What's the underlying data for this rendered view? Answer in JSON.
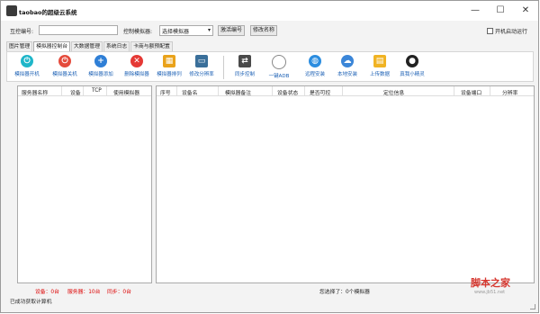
{
  "window": {
    "title": "taobao的超级云系统",
    "minimize": "—",
    "maximize": "☐",
    "close": "✕"
  },
  "controls": {
    "number_label": "互控编号:",
    "number_value": "",
    "control_sim_label": "控制模拟器:",
    "control_sim_value": "选择模拟器",
    "activate_label": "激活编号",
    "rename_label": "修改名称",
    "autostart_label": "开机启动运行"
  },
  "tabs": [
    "图片管理",
    "模拟器控制台",
    "大数据管理",
    "系统日志",
    "卡商与额预配置"
  ],
  "active_tab": 1,
  "toolbar": [
    {
      "label": "模拟器开机",
      "icon": "power-icon",
      "color": "#1fb6c9",
      "glyph": "⏻"
    },
    {
      "label": "模拟器关机",
      "icon": "power-off-icon",
      "color": "#e54b3c",
      "glyph": "⏻"
    },
    {
      "label": "模拟器添加",
      "icon": "plus-icon",
      "color": "#2f7fd6",
      "glyph": "+"
    },
    {
      "label": "删除模拟器",
      "icon": "delete-icon",
      "color": "#e53935",
      "glyph": "✕"
    },
    {
      "label": "模拟器排列",
      "icon": "grid-icon",
      "color": "#e9a21a",
      "glyph": "▦"
    },
    {
      "label": "修改分辨率",
      "icon": "monitor-icon",
      "color": "#3a6f9a",
      "glyph": "▭"
    },
    {
      "label": "同步控制",
      "icon": "sync-icon",
      "color": "#4a4a4a",
      "glyph": "⇄"
    },
    {
      "label": "一键ADB",
      "icon": "circle-icon",
      "color": "#ffffff",
      "glyph": "○"
    },
    {
      "label": "远程安装",
      "icon": "planet-icon",
      "color": "#2b8de0",
      "glyph": "◍"
    },
    {
      "label": "本地安装",
      "icon": "cloud-icon",
      "color": "#3b86d8",
      "glyph": "☁"
    },
    {
      "label": "上传数据",
      "icon": "folder-icon",
      "color": "#f0b323",
      "glyph": "▤"
    },
    {
      "label": "真我小精灵",
      "icon": "ghost-icon",
      "color": "#222222",
      "glyph": "●"
    }
  ],
  "left_table": {
    "headers": [
      "服务器名称",
      "设备",
      "TCP",
      "使用模拟器"
    ]
  },
  "right_table": {
    "headers": [
      "序号",
      "设备名",
      "模拟器备注",
      "设备状态",
      "是否可控",
      "定位信息",
      "设备端口",
      "分辨率"
    ]
  },
  "status": {
    "devices": "设备：0台",
    "servers": "服务器：10台",
    "sync": "同步：0台",
    "selected": "您选择了：0个模拟器",
    "bottom": "已成功获取计算机"
  },
  "watermark": {
    "main": "脚本之家",
    "sub": "www.jb51.net"
  }
}
